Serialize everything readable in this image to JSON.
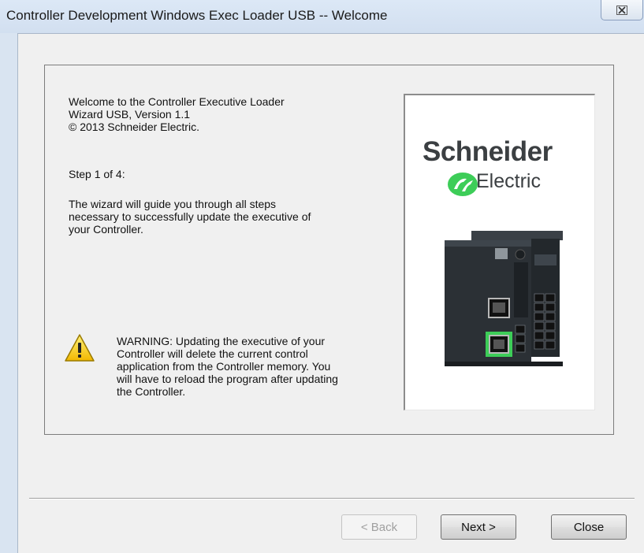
{
  "window": {
    "title": "Controller Development Windows Exec Loader USB -- Welcome",
    "close_glyph": "☒"
  },
  "welcome": {
    "line1": "Welcome to the Controller Executive Loader",
    "line2": "Wizard USB, Version 1.1",
    "line3": "© 2013 Schneider Electric."
  },
  "step": "Step 1 of 4:",
  "guide": {
    "line1": "The wizard will guide you through all steps",
    "line2": "necessary to successfully update the executive of",
    "line3": "your Controller."
  },
  "warning": {
    "icon": "warning-icon",
    "line1": "WARNING:  Updating the executive of your",
    "line2": "Controller will delete the current control",
    "line3": "application from the Controller memory.  You",
    "line4": "will have to reload the program after updating",
    "line5": "the Controller."
  },
  "logo": {
    "brand": "Schneider",
    "sub": "Electric"
  },
  "buttons": {
    "back": "< Back",
    "next": "Next >",
    "close": "Close"
  },
  "colors": {
    "brand_green": "#3dcd58",
    "warning_yellow": "#f5c400"
  }
}
